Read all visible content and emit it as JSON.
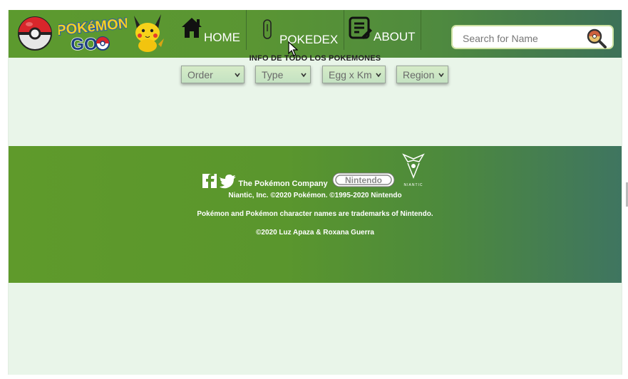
{
  "nav": {
    "home_label": "HOME",
    "pokedex_label": "POKEDEX",
    "about_label": "ABOUT"
  },
  "search": {
    "placeholder": "Search for Name"
  },
  "main": {
    "subtitle": "INFO DE TODO LOS POKEMONES",
    "filters": [
      {
        "label": "Order"
      },
      {
        "label": "Type"
      },
      {
        "label": "Egg x Km"
      },
      {
        "label": "Region"
      }
    ]
  },
  "footer": {
    "company": "The Pokémon Company",
    "nintendo": "Nintendo",
    "niantic": "NIANTIC",
    "line1": "Niantic, Inc. ©2020 Pokémon. ©1995-2020 Nintendo",
    "line2": "Pokémon and Pokémon character names are trademarks of Nintendo.",
    "line3": "©2020 Luz Apaza & Roxana Guerra"
  },
  "logo_text": {
    "pokemon": "POKéMON",
    "go": "GO"
  },
  "colors": {
    "header_green": "#5c9a2e",
    "header_teal": "#3d7158",
    "page_bg": "#e9f5e9",
    "pokemon_yellow": "#f5d020",
    "pokemon_blue": "#2a5ba8"
  },
  "icons": [
    "pokeball-icon",
    "pokemon-go-logo",
    "pikachu-icon",
    "home-icon",
    "pokedex-icon",
    "about-icon",
    "search-icon",
    "facebook-icon",
    "twitter-icon",
    "niantic-logo",
    "cursor-icon"
  ]
}
